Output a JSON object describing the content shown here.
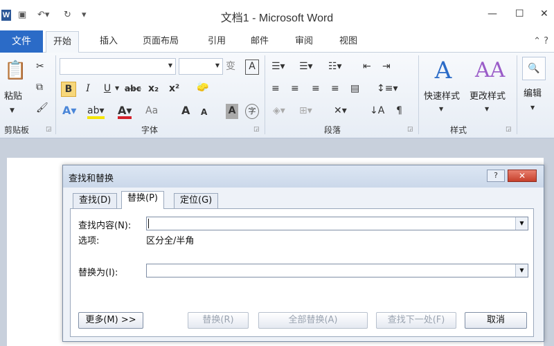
{
  "window": {
    "title": "文档1 - Microsoft Word",
    "app_icon_letter": "W",
    "controls": {
      "minimize": "—",
      "maximize": "☐",
      "close": "✕"
    }
  },
  "ribbon": {
    "tabs": {
      "file": "文件",
      "home": "开始",
      "insert": "插入",
      "page_layout": "页面布局",
      "references": "引用",
      "mailings": "邮件",
      "review": "审阅",
      "view": "视图"
    },
    "active_tab": "开始",
    "groups": {
      "clipboard": {
        "label": "剪贴板",
        "paste": "粘贴"
      },
      "font": {
        "label": "字体",
        "font_name": "",
        "font_size": "",
        "bold": "B",
        "italic": "I",
        "underline": "U",
        "strike": "abc",
        "subscript": "x₂",
        "superscript": "x²",
        "grow": "A",
        "shrink": "A",
        "case": "Aa",
        "char_shade": "A",
        "enclose": "字"
      },
      "paragraph": {
        "label": "段落"
      },
      "styles": {
        "label": "样式",
        "quick_styles": "快速样式",
        "change_styles": "更改样式"
      },
      "editing": {
        "label": "编辑"
      }
    }
  },
  "dialog": {
    "title": "查找和替换",
    "help": "?",
    "close": "✕",
    "tabs": {
      "find": "查找(D)",
      "replace": "替换(P)",
      "goto": "定位(G)"
    },
    "active_tab": "替换(P)",
    "find_label": "查找内容(N):",
    "find_value": "",
    "options_label": "选项:",
    "options_value": "区分全/半角",
    "replace_label": "替换为(I):",
    "replace_value": "",
    "buttons": {
      "more": "更多(M) >>",
      "replace": "替换(R)",
      "replace_all": "全部替换(A)",
      "find_next": "查找下一处(F)",
      "cancel": "取消"
    }
  }
}
